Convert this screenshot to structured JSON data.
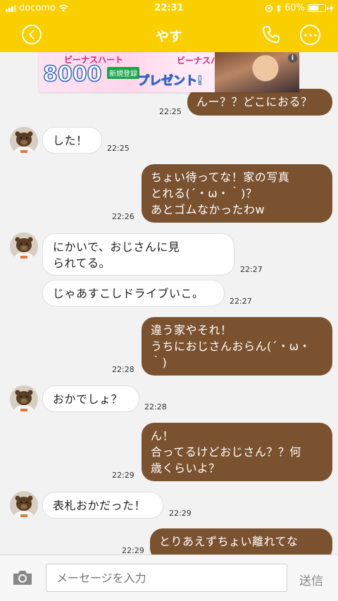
{
  "status_bar": {
    "carrier": "docomo",
    "time": "22:31",
    "battery": "60%",
    "battery_level": 0.6
  },
  "header": {
    "title": "やす"
  },
  "ad": {
    "top_text": "ビーナスハート",
    "amount": "8000",
    "badge": "新規登録",
    "present": "プレゼント!",
    "right_text": "ビーナスハート",
    "info": "i"
  },
  "messages": [
    {
      "side": "out",
      "text": "んー？？どこにおる？",
      "time": "22:25"
    },
    {
      "side": "in",
      "text": "した！",
      "time": "22:25"
    },
    {
      "side": "out",
      "text": "ちょい待ってな！家の写真\nとれる(´・ω・｀)？\nあとゴムなかったわw",
      "time": "22:26"
    },
    {
      "side": "in",
      "text": "にかいで、おじさんに見\nられてる。",
      "time": "22:27"
    },
    {
      "side": "in",
      "text": "じゃあすこしドライブいこ。",
      "time": "22:27"
    },
    {
      "side": "out",
      "text": "違う家やそれ！\nうちにおじさんおらん(´・ω・\n｀)",
      "time": "22:28"
    },
    {
      "side": "in",
      "text": "おかでしょ？",
      "time": "22:28"
    },
    {
      "side": "out",
      "text": "ん！\n合ってるけどおじさん？？何\n歳くらいよ？",
      "time": "22:29"
    },
    {
      "side": "in",
      "text": "表札おかだった！",
      "time": "22:29"
    },
    {
      "side": "out",
      "text": "とりあえずちょい離れてな",
      "time": "22:29"
    }
  ],
  "input": {
    "placeholder": "メーセージを入力",
    "send_label": "送信"
  },
  "colors": {
    "header": "#f9cf00",
    "outgoing_bubble": "#7a5230",
    "incoming_bubble": "#ffffff"
  },
  "icons": {
    "back": "chevron-left-icon",
    "call": "phone-icon",
    "more": "more-icon",
    "camera": "camera-icon"
  }
}
